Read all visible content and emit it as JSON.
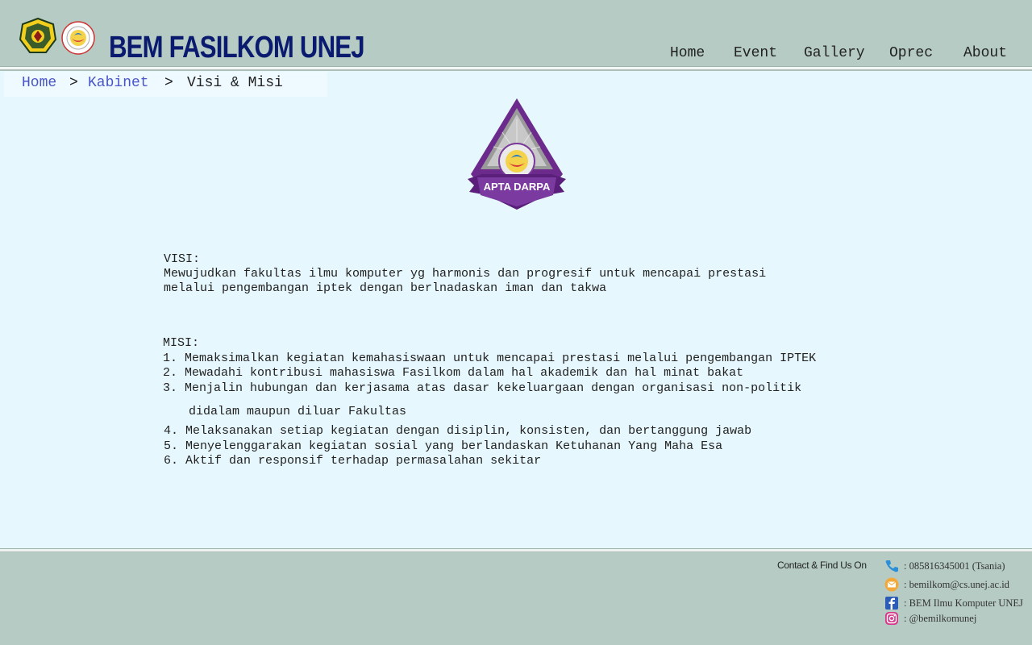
{
  "header": {
    "brand": "BEM FASILKOM UNEJ",
    "logo_unej_text": "UNIVERSITAS JEMBER",
    "nav": [
      "Home",
      "Event",
      "Gallery",
      "Oprec",
      "About"
    ]
  },
  "breadcrumb": {
    "home": "Home",
    "sep1": ">",
    "kabinet": "Kabinet",
    "sep2": ">",
    "current": "Visi & Misi"
  },
  "emblem": {
    "label": "APTA DARPA"
  },
  "visi": {
    "heading": "VISI:",
    "line1": "Mewujudkan fakultas ilmu komputer yg harmonis dan progresif untuk mencapai prestasi",
    "line2": "melalui pengembangan iptek dengan berlnadaskan iman dan takwa"
  },
  "misi": {
    "heading": "MISI:",
    "item1": "1. Memaksimalkan kegiatan kemahasiswaan untuk mencapai prestasi melalui pengembangan IPTEK",
    "item2": "2. Mewadahi kontribusi mahasiswa Fasilkom dalam hal akademik dan hal minat bakat",
    "item3": "3. Menjalin hubungan dan kerjasama atas dasar kekeluargaan dengan organisasi non-politik",
    "item3_cont": "didalam maupun diluar Fakultas",
    "item4": "4. Melaksanakan setiap kegiatan dengan disiplin, konsisten, dan bertanggung jawab",
    "item5": "5. Menyelenggarakan kegiatan sosial yang berlandaskan Ketuhanan Yang Maha Esa",
    "item6": "6. Aktif dan responsif terhadap permasalahan sekitar"
  },
  "footer": {
    "title": "Contact & Find Us On",
    "phone": ": 085816345001 (Tsania)",
    "email": ": bemilkom@cs.unej.ac.id",
    "facebook": ": BEM Ilmu Komputer UNEJ",
    "instagram": ": @bemilkomunej"
  },
  "colors": {
    "header_bg": "#b5cbc3",
    "page_bg": "#e6f7fd",
    "brand": "#0a1a6e",
    "link": "#4a56c8",
    "emblem_purple": "#6b2a8c"
  }
}
